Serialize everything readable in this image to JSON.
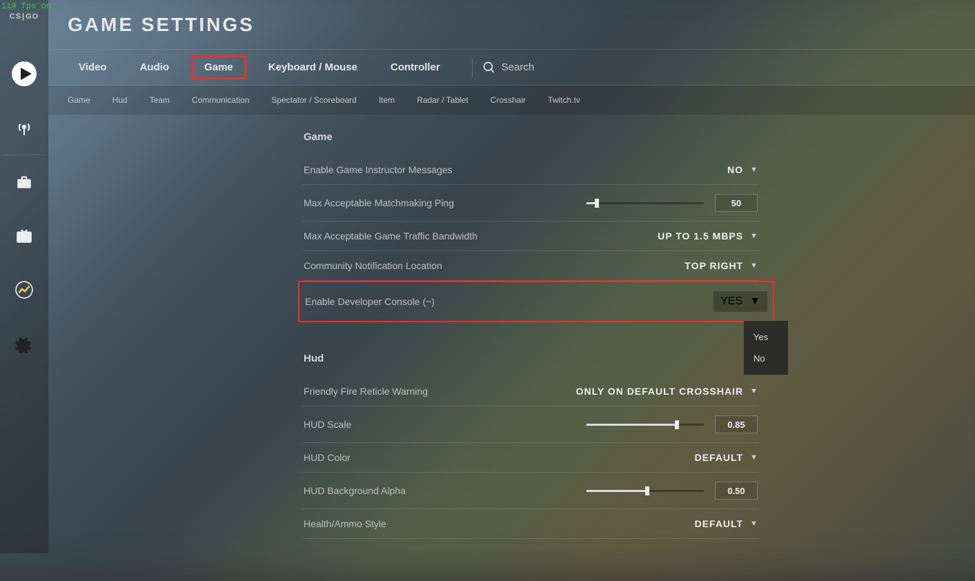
{
  "fps_overlay": "119 fps on",
  "brand": "CS:GO",
  "page_title": "GAME SETTINGS",
  "tabs": {
    "video": "Video",
    "audio": "Audio",
    "game": "Game",
    "keyboard": "Keyboard / Mouse",
    "controller": "Controller"
  },
  "search_placeholder": "Search",
  "subtabs": {
    "game": "Game",
    "hud": "Hud",
    "team": "Team",
    "communication": "Communication",
    "spectator": "Spectator / Scoreboard",
    "item": "Item",
    "radar": "Radar / Tablet",
    "crosshair": "Crosshair",
    "twitch": "Twitch.tv"
  },
  "sections": {
    "game": {
      "header": "Game",
      "rows": {
        "instructor": {
          "label": "Enable Game Instructor Messages",
          "value": "NO"
        },
        "ping": {
          "label": "Max Acceptable Matchmaking Ping",
          "value": "50",
          "pct": 7
        },
        "bandwidth": {
          "label": "Max Acceptable Game Traffic Bandwidth",
          "value": "UP TO 1.5 MBPS"
        },
        "notif": {
          "label": "Community Notification Location",
          "value": "TOP RIGHT"
        },
        "console": {
          "label": "Enable Developer Console (~)",
          "value": "YES",
          "options": [
            "Yes",
            "No"
          ]
        }
      }
    },
    "hud": {
      "header": "Hud",
      "rows": {
        "ffire": {
          "label": "Friendly Fire Reticle Warning",
          "value": "ONLY ON DEFAULT CROSSHAIR"
        },
        "scale": {
          "label": "HUD Scale",
          "value": "0.85",
          "pct": 75
        },
        "color": {
          "label": "HUD Color",
          "value": "DEFAULT"
        },
        "alpha": {
          "label": "HUD Background Alpha",
          "value": "0.50",
          "pct": 50
        },
        "health": {
          "label": "Health/Ammo Style",
          "value": "DEFAULT"
        }
      }
    }
  }
}
